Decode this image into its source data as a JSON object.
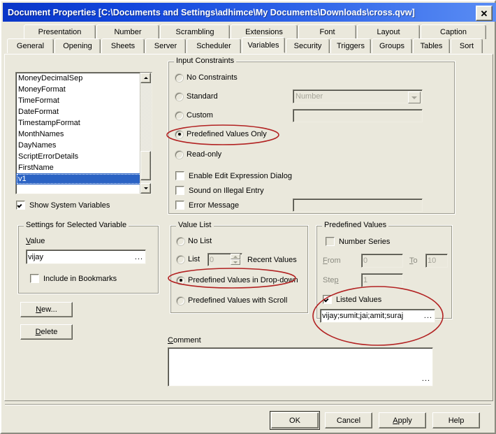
{
  "window": {
    "title": "Document Properties [C:\\Documents and Settings\\adhimce\\My Documents\\Downloads\\cross.qvw]",
    "close_label": "✕"
  },
  "tabs": {
    "row1": [
      {
        "label": "Presentation",
        "active": false
      },
      {
        "label": "Number",
        "active": false
      },
      {
        "label": "Scrambling",
        "active": false
      },
      {
        "label": "Extensions",
        "active": false
      },
      {
        "label": "Font",
        "active": false
      },
      {
        "label": "Layout",
        "active": false
      },
      {
        "label": "Caption",
        "active": false
      }
    ],
    "row2": [
      {
        "label": "General",
        "active": false
      },
      {
        "label": "Opening",
        "active": false
      },
      {
        "label": "Sheets",
        "active": false
      },
      {
        "label": "Server",
        "active": false
      },
      {
        "label": "Scheduler",
        "active": false
      },
      {
        "label": "Variables",
        "active": true
      },
      {
        "label": "Security",
        "active": false
      },
      {
        "label": "Triggers",
        "active": false
      },
      {
        "label": "Groups",
        "active": false
      },
      {
        "label": "Tables",
        "active": false
      },
      {
        "label": "Sort",
        "active": false
      }
    ]
  },
  "variable_list": {
    "items": [
      "MoneyDecimalSep",
      "MoneyFormat",
      "TimeFormat",
      "DateFormat",
      "TimestampFormat",
      "MonthNames",
      "DayNames",
      "ScriptErrorDetails",
      "FirstName",
      "v1"
    ],
    "selected": "v1",
    "show_system_variables_label": "Show System Variables",
    "show_system_variables_checked": true
  },
  "input_constraints": {
    "title": "Input Constraints",
    "options": [
      {
        "label": "No Constraints",
        "selected": false
      },
      {
        "label": "Standard",
        "selected": false
      },
      {
        "label": "Custom",
        "selected": false
      },
      {
        "label": "Predefined Values Only",
        "selected": true
      },
      {
        "label": "Read-only",
        "selected": false
      }
    ],
    "standard_combo_value": "Number",
    "custom_value": "",
    "checkboxes": [
      {
        "label": "Enable Edit Expression Dialog",
        "checked": false
      },
      {
        "label": "Sound on Illegal Entry",
        "checked": false
      },
      {
        "label": "Error Message",
        "checked": false
      }
    ],
    "error_message_value": ""
  },
  "settings_for_selected_variable": {
    "title": "Settings for Selected Variable",
    "value_label": "Value",
    "value": "vijay",
    "include_in_bookmarks_label": "Include in Bookmarks",
    "include_in_bookmarks_checked": false
  },
  "buttons": {
    "new_label": "New...",
    "delete_label": "Delete"
  },
  "value_list": {
    "title": "Value List",
    "options": [
      {
        "label": "No List",
        "selected": false
      },
      {
        "label": "List",
        "selected": false
      },
      {
        "label": "Predefined Values in Drop-down",
        "selected": true
      },
      {
        "label": "Predefined Values with Scroll",
        "selected": false
      }
    ],
    "list_count": "0",
    "recent_values_label": "Recent Values"
  },
  "predefined_values": {
    "title": "Predefined Values",
    "number_series_label": "Number Series",
    "number_series_checked": false,
    "from_label": "From",
    "from_value": "0",
    "to_label": "To",
    "to_value": "10",
    "step_label": "Step",
    "step_value": "1",
    "listed_values_label": "Listed Values",
    "listed_values_checked": true,
    "listed_values": "vijay;sumit;jai;amit;suraj"
  },
  "comment": {
    "label": "Comment",
    "value": ""
  },
  "dialog_buttons": [
    {
      "label": "OK",
      "default": true
    },
    {
      "label": "Cancel",
      "default": false
    },
    {
      "label": "Apply",
      "default": false
    },
    {
      "label": "Help",
      "default": false
    }
  ],
  "colors": {
    "dialog_bg": "#EAE8DC",
    "titlebar_start": "#0A36C8",
    "titlebar_end": "#5A8DF4",
    "selection": "#2B63C4",
    "annotation": "#B22222"
  }
}
